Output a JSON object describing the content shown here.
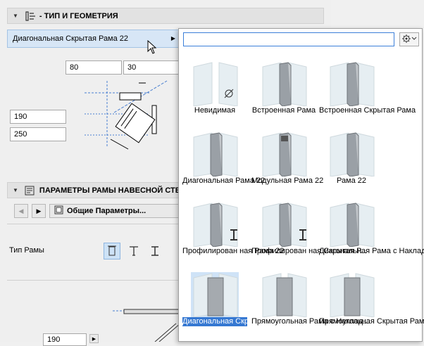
{
  "geometry_section": {
    "title": "- ТИП И ГЕОМЕТРИЯ"
  },
  "frame_type_selector": {
    "value": "Диагональная Скрытая Рама 22"
  },
  "dimensions": {
    "width_a": "80",
    "width_b": "30",
    "depth_a": "190",
    "depth_b": "250"
  },
  "frame_params_section": {
    "title": "ПАРАМЕТРЫ РАМЫ НАВЕСНОЙ СТЕНЫ"
  },
  "params_nav": {
    "general_label": "Общие Параметры..."
  },
  "frame_type": {
    "label": "Тип Рамы"
  },
  "bottom_field": {
    "value": "190"
  },
  "search": {
    "placeholder": "",
    "value": ""
  },
  "gallery": {
    "selected_index": 9,
    "items": [
      {
        "label": "Невидимая",
        "icon": "invisible-frame"
      },
      {
        "label": "Встроенная Рама",
        "icon": "built-in-frame"
      },
      {
        "label": "Встроенная Скрытая Рама",
        "icon": "built-in-hidden-frame"
      },
      {
        "label": "Диагональная Рама 22",
        "icon": "diagonal-frame"
      },
      {
        "label": "Модульная Рама 22",
        "icon": "modular-frame"
      },
      {
        "label": "Рама 22",
        "icon": "frame"
      },
      {
        "label": "Профилирован ная Рама 22",
        "icon": "profiled-frame"
      },
      {
        "label": "Профилирован ная Скрытая Р...",
        "icon": "profiled-hidden-frame"
      },
      {
        "label": "Диагональная Рама с Наклад...",
        "icon": "diagonal-frame-cover"
      },
      {
        "label": "Диагональная Скрытая Рама ...",
        "icon": "diagonal-hidden-frame"
      },
      {
        "label": "Прямоугольная Рама с Наклад...",
        "icon": "rectangular-frame-cover"
      },
      {
        "label": "Прямоугольная Скрытая Рама",
        "icon": "rectangular-hidden-frame"
      }
    ]
  }
}
